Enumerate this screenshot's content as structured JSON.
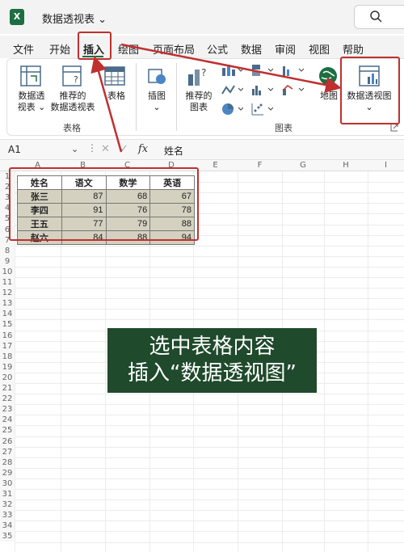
{
  "titlebar": {
    "app_icon": "X",
    "title": "数据透视表 ⌄",
    "search_icon": "search-icon"
  },
  "tabs": [
    "文件",
    "开始",
    "插入",
    "绘图",
    "页面布局",
    "公式",
    "数据",
    "审阅",
    "视图",
    "帮助"
  ],
  "active_tab": "插入",
  "ribbon": {
    "pivot_table": "数据透\n视表 ⌄",
    "recommended_pivot": "推荐的\n数据透视表",
    "table": "表格",
    "illustrations": "插图\n⌄",
    "recommended_charts": "推荐的\n图表",
    "maps": "地图",
    "pivot_chart": "数据透视图\n⌄",
    "group_tables": "表格",
    "group_charts": "图表"
  },
  "formula_bar": {
    "name_box": "A1",
    "fx": "fx",
    "value": "姓名"
  },
  "columns": [
    "A",
    "B",
    "C",
    "D",
    "E",
    "F",
    "G",
    "H",
    "I"
  ],
  "rows": [
    "1",
    "2",
    "3",
    "4",
    "5",
    "6",
    "7",
    "8",
    "9",
    "10",
    "11",
    "12",
    "13",
    "14",
    "15",
    "16",
    "17",
    "18",
    "19",
    "20",
    "21",
    "22",
    "23",
    "24",
    "25",
    "26",
    "27",
    "28",
    "29",
    "30",
    "31",
    "32",
    "33",
    "34",
    "35"
  ],
  "table": {
    "headers": [
      "姓名",
      "语文",
      "数学",
      "英语"
    ],
    "rows": [
      [
        "张三",
        "87",
        "68",
        "67"
      ],
      [
        "李四",
        "91",
        "76",
        "78"
      ],
      [
        "王五",
        "77",
        "79",
        "88"
      ],
      [
        "赵六",
        "84",
        "88",
        "94"
      ]
    ]
  },
  "banner": {
    "line1": "选中表格内容",
    "line2": "插入“数据透视图”"
  },
  "colors": {
    "excel_green": "#1d6f42",
    "annotation_red": "#c0302f",
    "banner_bg": "#1f4a2c",
    "table_fill": "#d4d1c0"
  }
}
